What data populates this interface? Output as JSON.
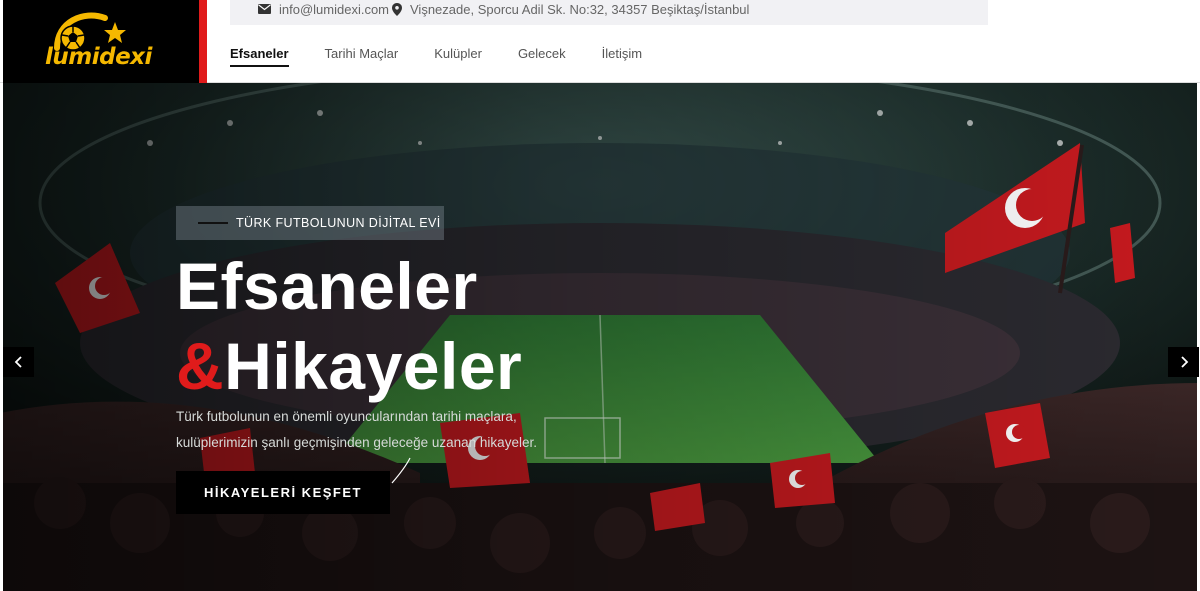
{
  "brand": {
    "name": "lumidexi",
    "logo_color": "#f5b800",
    "accent": "#e01b1b"
  },
  "topbar": {
    "email": "info@lumidexi.com",
    "address": "Vişnezade, Sporcu Adil Sk. No:32, 34357 Beşiktaş/İstanbul",
    "email_icon": "envelope-icon",
    "address_icon": "map-pin-icon"
  },
  "nav": {
    "items": [
      {
        "label": "Efsaneler",
        "active": true
      },
      {
        "label": "Tarihi Maçlar",
        "active": false
      },
      {
        "label": "Kulüpler",
        "active": false
      },
      {
        "label": "Gelecek",
        "active": false
      },
      {
        "label": "İletişim",
        "active": false
      }
    ]
  },
  "hero": {
    "badge": "TÜRK FUTBOLUNUN DİJİTAL EVİ",
    "title_line1": "Efsaneler",
    "title_amp": "&",
    "title_line2": "Hikayeler",
    "description": "Türk futbolunun en önemli oyuncularından tarihi maçlara, kulüplerimizin şanlı geçmişinden geleceğe uzanan hikayeler.",
    "cta_label": "HİKAYELERİ KEŞFET",
    "prev_icon": "chevron-left-icon",
    "next_icon": "chevron-right-icon"
  }
}
